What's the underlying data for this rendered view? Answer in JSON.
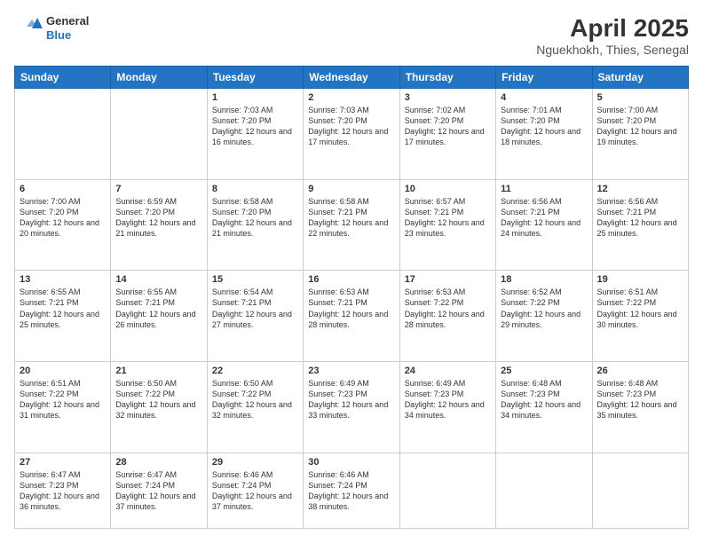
{
  "header": {
    "logo_line1": "General",
    "logo_line2": "Blue",
    "title": "April 2025",
    "subtitle": "Nguekhokh, Thies, Senegal"
  },
  "days_of_week": [
    "Sunday",
    "Monday",
    "Tuesday",
    "Wednesday",
    "Thursday",
    "Friday",
    "Saturday"
  ],
  "weeks": [
    [
      {
        "day": "",
        "sunrise": "",
        "sunset": "",
        "daylight": ""
      },
      {
        "day": "",
        "sunrise": "",
        "sunset": "",
        "daylight": ""
      },
      {
        "day": "1",
        "sunrise": "Sunrise: 7:03 AM",
        "sunset": "Sunset: 7:20 PM",
        "daylight": "Daylight: 12 hours and 16 minutes."
      },
      {
        "day": "2",
        "sunrise": "Sunrise: 7:03 AM",
        "sunset": "Sunset: 7:20 PM",
        "daylight": "Daylight: 12 hours and 17 minutes."
      },
      {
        "day": "3",
        "sunrise": "Sunrise: 7:02 AM",
        "sunset": "Sunset: 7:20 PM",
        "daylight": "Daylight: 12 hours and 17 minutes."
      },
      {
        "day": "4",
        "sunrise": "Sunrise: 7:01 AM",
        "sunset": "Sunset: 7:20 PM",
        "daylight": "Daylight: 12 hours and 18 minutes."
      },
      {
        "day": "5",
        "sunrise": "Sunrise: 7:00 AM",
        "sunset": "Sunset: 7:20 PM",
        "daylight": "Daylight: 12 hours and 19 minutes."
      }
    ],
    [
      {
        "day": "6",
        "sunrise": "Sunrise: 7:00 AM",
        "sunset": "Sunset: 7:20 PM",
        "daylight": "Daylight: 12 hours and 20 minutes."
      },
      {
        "day": "7",
        "sunrise": "Sunrise: 6:59 AM",
        "sunset": "Sunset: 7:20 PM",
        "daylight": "Daylight: 12 hours and 21 minutes."
      },
      {
        "day": "8",
        "sunrise": "Sunrise: 6:58 AM",
        "sunset": "Sunset: 7:20 PM",
        "daylight": "Daylight: 12 hours and 21 minutes."
      },
      {
        "day": "9",
        "sunrise": "Sunrise: 6:58 AM",
        "sunset": "Sunset: 7:21 PM",
        "daylight": "Daylight: 12 hours and 22 minutes."
      },
      {
        "day": "10",
        "sunrise": "Sunrise: 6:57 AM",
        "sunset": "Sunset: 7:21 PM",
        "daylight": "Daylight: 12 hours and 23 minutes."
      },
      {
        "day": "11",
        "sunrise": "Sunrise: 6:56 AM",
        "sunset": "Sunset: 7:21 PM",
        "daylight": "Daylight: 12 hours and 24 minutes."
      },
      {
        "day": "12",
        "sunrise": "Sunrise: 6:56 AM",
        "sunset": "Sunset: 7:21 PM",
        "daylight": "Daylight: 12 hours and 25 minutes."
      }
    ],
    [
      {
        "day": "13",
        "sunrise": "Sunrise: 6:55 AM",
        "sunset": "Sunset: 7:21 PM",
        "daylight": "Daylight: 12 hours and 25 minutes."
      },
      {
        "day": "14",
        "sunrise": "Sunrise: 6:55 AM",
        "sunset": "Sunset: 7:21 PM",
        "daylight": "Daylight: 12 hours and 26 minutes."
      },
      {
        "day": "15",
        "sunrise": "Sunrise: 6:54 AM",
        "sunset": "Sunset: 7:21 PM",
        "daylight": "Daylight: 12 hours and 27 minutes."
      },
      {
        "day": "16",
        "sunrise": "Sunrise: 6:53 AM",
        "sunset": "Sunset: 7:21 PM",
        "daylight": "Daylight: 12 hours and 28 minutes."
      },
      {
        "day": "17",
        "sunrise": "Sunrise: 6:53 AM",
        "sunset": "Sunset: 7:22 PM",
        "daylight": "Daylight: 12 hours and 28 minutes."
      },
      {
        "day": "18",
        "sunrise": "Sunrise: 6:52 AM",
        "sunset": "Sunset: 7:22 PM",
        "daylight": "Daylight: 12 hours and 29 minutes."
      },
      {
        "day": "19",
        "sunrise": "Sunrise: 6:51 AM",
        "sunset": "Sunset: 7:22 PM",
        "daylight": "Daylight: 12 hours and 30 minutes."
      }
    ],
    [
      {
        "day": "20",
        "sunrise": "Sunrise: 6:51 AM",
        "sunset": "Sunset: 7:22 PM",
        "daylight": "Daylight: 12 hours and 31 minutes."
      },
      {
        "day": "21",
        "sunrise": "Sunrise: 6:50 AM",
        "sunset": "Sunset: 7:22 PM",
        "daylight": "Daylight: 12 hours and 32 minutes."
      },
      {
        "day": "22",
        "sunrise": "Sunrise: 6:50 AM",
        "sunset": "Sunset: 7:22 PM",
        "daylight": "Daylight: 12 hours and 32 minutes."
      },
      {
        "day": "23",
        "sunrise": "Sunrise: 6:49 AM",
        "sunset": "Sunset: 7:23 PM",
        "daylight": "Daylight: 12 hours and 33 minutes."
      },
      {
        "day": "24",
        "sunrise": "Sunrise: 6:49 AM",
        "sunset": "Sunset: 7:23 PM",
        "daylight": "Daylight: 12 hours and 34 minutes."
      },
      {
        "day": "25",
        "sunrise": "Sunrise: 6:48 AM",
        "sunset": "Sunset: 7:23 PM",
        "daylight": "Daylight: 12 hours and 34 minutes."
      },
      {
        "day": "26",
        "sunrise": "Sunrise: 6:48 AM",
        "sunset": "Sunset: 7:23 PM",
        "daylight": "Daylight: 12 hours and 35 minutes."
      }
    ],
    [
      {
        "day": "27",
        "sunrise": "Sunrise: 6:47 AM",
        "sunset": "Sunset: 7:23 PM",
        "daylight": "Daylight: 12 hours and 36 minutes."
      },
      {
        "day": "28",
        "sunrise": "Sunrise: 6:47 AM",
        "sunset": "Sunset: 7:24 PM",
        "daylight": "Daylight: 12 hours and 37 minutes."
      },
      {
        "day": "29",
        "sunrise": "Sunrise: 6:46 AM",
        "sunset": "Sunset: 7:24 PM",
        "daylight": "Daylight: 12 hours and 37 minutes."
      },
      {
        "day": "30",
        "sunrise": "Sunrise: 6:46 AM",
        "sunset": "Sunset: 7:24 PM",
        "daylight": "Daylight: 12 hours and 38 minutes."
      },
      {
        "day": "",
        "sunrise": "",
        "sunset": "",
        "daylight": ""
      },
      {
        "day": "",
        "sunrise": "",
        "sunset": "",
        "daylight": ""
      },
      {
        "day": "",
        "sunrise": "",
        "sunset": "",
        "daylight": ""
      }
    ]
  ]
}
